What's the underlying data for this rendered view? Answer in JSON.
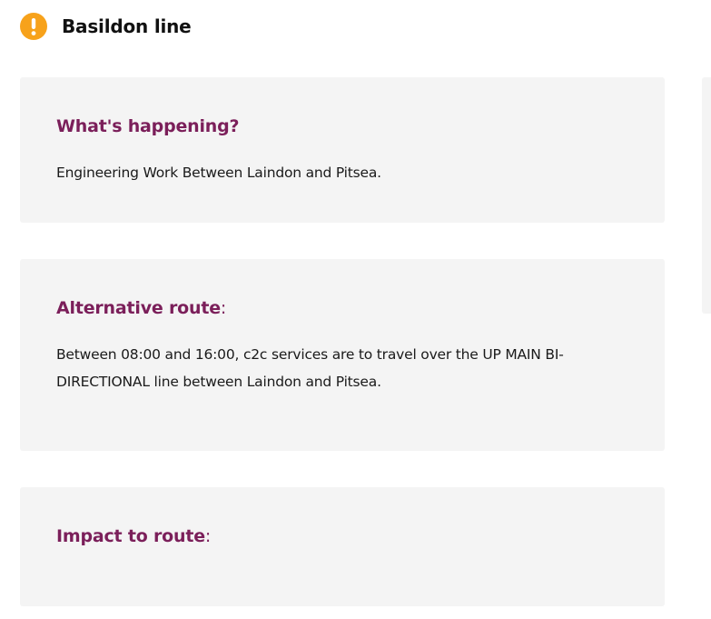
{
  "header": {
    "icon": "exclamation-circle-icon",
    "icon_color": "#f7a21b",
    "title": "Basildon line"
  },
  "sections": [
    {
      "heading": "What's happening?",
      "body": "Engineering Work Between Laindon and Pitsea."
    },
    {
      "heading": "Alternative route",
      "heading_suffix": ":",
      "body": "Between 08:00 and 16:00, c2c services are to travel over the UP MAIN BI-DIRECTIONAL line between Laindon and Pitsea."
    },
    {
      "heading": "Impact to route",
      "heading_suffix": ":",
      "body": ""
    }
  ],
  "colors": {
    "heading": "#7b1f5a",
    "panel_background": "#f4f4f4",
    "alert": "#f7a21b"
  }
}
